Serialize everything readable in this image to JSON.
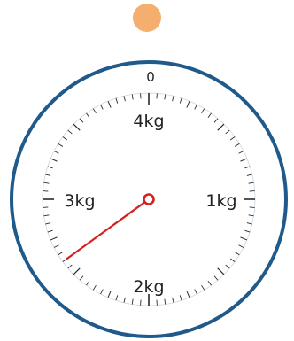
{
  "scale": {
    "zero_label": "0",
    "labels": [
      "1kg",
      "2kg",
      "3kg",
      "4kg"
    ],
    "max_kg": 4,
    "minor_ticks_per_kg": 20,
    "reading_kg": 2.6,
    "colors": {
      "rim": "#1f5a8a",
      "ticks": "#2a2a2a",
      "needle": "#d42020",
      "indicator_dot": "#f4ae6e"
    }
  }
}
